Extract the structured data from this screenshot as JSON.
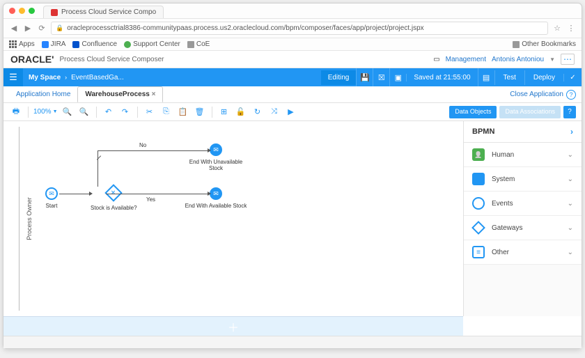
{
  "browser": {
    "tab_title": "Process Cloud Service Compo",
    "url": "oracleprocessctrial8386-communitypaas.process.us2.oraclecloud.com/bpm/composer/faces/app/project/project.jspx",
    "bookmarks": {
      "apps": "Apps",
      "jira": "JIRA",
      "confluence": "Confluence",
      "support": "Support Center",
      "coe": "CoE",
      "other": "Other Bookmarks"
    }
  },
  "brand": {
    "logo": "ORACLE'",
    "product": "Process Cloud Service Composer",
    "management": "Management",
    "user": "Antonis Antoniou"
  },
  "bluebar": {
    "myspace": "My Space",
    "breadcrumb": "EventBasedGa...",
    "editing": "Editing",
    "saved": "Saved at 21:55:00",
    "test": "Test",
    "deploy": "Deploy"
  },
  "tabs": {
    "home": "Application Home",
    "process": "WarehouseProcess",
    "close_app": "Close Application"
  },
  "toolbar": {
    "zoom": "100%",
    "data_objects": "Data Objects",
    "data_assoc": "Data Associations"
  },
  "canvas": {
    "swimlane": "Process Owner",
    "start": "Start",
    "gateway": "Stock is Available?",
    "no": "No",
    "yes": "Yes",
    "end_unavail": "End With Unavailable Stock",
    "end_avail": "End With Available Stock"
  },
  "palette": {
    "header": "BPMN",
    "items": {
      "human": "Human",
      "system": "System",
      "events": "Events",
      "gateways": "Gateways",
      "other": "Other"
    }
  }
}
